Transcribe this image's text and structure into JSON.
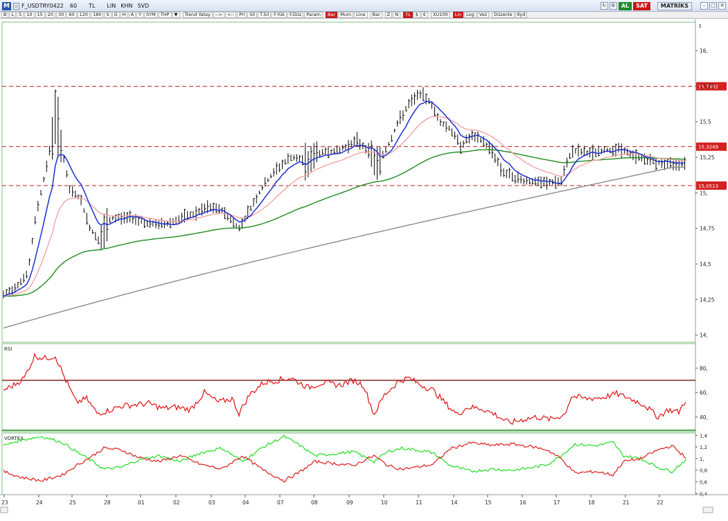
{
  "window": {
    "app_logo": "M",
    "title": "F_USDTRY0422",
    "period": "60",
    "al_label": "AL",
    "sat_label": "SAT",
    "matriks_label": "MATRİKS"
  },
  "toolbar": {
    "items": [
      "B",
      "L",
      "5",
      "10",
      "15",
      "20",
      "30",
      "60",
      "120",
      "180",
      "S",
      "G",
      "H",
      "A",
      "Y",
      "SYM",
      "THP",
      "▼",
      "Trend Yatay",
      "-->",
      "<--",
      "Prl",
      "Sil",
      "T.Sil",
      "F.Yük",
      "F.Düz",
      "Param",
      "Bar",
      "Mum",
      "Line",
      "Bar",
      "Z",
      "N",
      "TL",
      "$",
      "€",
      "XU100",
      "Lin",
      "Log",
      "Vez",
      "Düzenle",
      "Kyd"
    ],
    "labels": {
      "tl": "TL",
      "lin": "LIN",
      "khn": "KHN",
      "svd": "SVD"
    }
  },
  "price_panel": {
    "y_axis_ticks": [
      "16,",
      "15,75",
      "15,5",
      "15,25",
      "15,",
      "14,75",
      "14,5",
      "14,25",
      "14,"
    ],
    "ref_lines": [
      15.7492,
      15.3249,
      15.0513
    ],
    "ref_labels": [
      "15,7492",
      "15,3249",
      "15,0513"
    ],
    "colors": {
      "ma_fast": "#1b2fd0",
      "ma_mid": "#f2a3a3",
      "ma_slow": "#1e8a1e",
      "ma_long": "#8a8a8a",
      "ref_line": "#c81a1a",
      "bars": "#000000"
    }
  },
  "rsi_panel": {
    "label": "RSI",
    "y_axis_ticks": [
      "80,",
      "60,",
      "40,"
    ],
    "overbought": 70,
    "oversold": 20,
    "colors": {
      "line": "#e01010",
      "overbought": "#7a1010",
      "oversold": "#1e8a1e"
    }
  },
  "vortex_panel": {
    "label": "VORTEX",
    "y_axis_ticks": [
      "1,4",
      "1,2",
      "1,",
      "0,8",
      "0,6",
      "0,4"
    ],
    "colors": {
      "plus": "#22dd22",
      "minus": "#dd1a1a"
    }
  },
  "x_axis": {
    "labels": [
      "23",
      "24",
      "25",
      "28",
      "01",
      "02",
      "03",
      "04",
      "07",
      "08",
      "09",
      "10",
      "11",
      "14",
      "15",
      "16",
      "17",
      "18",
      "21",
      "22"
    ]
  }
}
